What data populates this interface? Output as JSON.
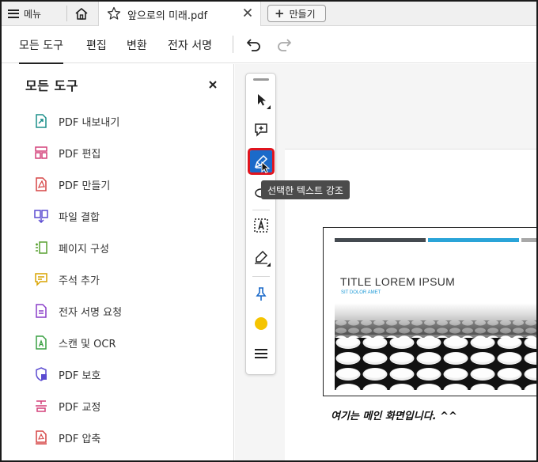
{
  "tabbar": {
    "menu_label": "메뉴",
    "doc_tab_title": "앞으로의 미래.pdf",
    "new_button_label": "만들기"
  },
  "toolbar": {
    "tabs": [
      {
        "label": "모든 도구"
      },
      {
        "label": "편집"
      },
      {
        "label": "변환"
      },
      {
        "label": "전자 서명"
      }
    ],
    "active_tab": "모든 도구"
  },
  "panel": {
    "title": "모든 도구",
    "items": [
      {
        "label": "PDF 내보내기",
        "icon": "pdf-export-icon"
      },
      {
        "label": "PDF 편집",
        "icon": "pdf-edit-icon"
      },
      {
        "label": "PDF 만들기",
        "icon": "pdf-create-icon"
      },
      {
        "label": "파일 결합",
        "icon": "combine-files-icon"
      },
      {
        "label": "페이지 구성",
        "icon": "organize-pages-icon"
      },
      {
        "label": "주석 추가",
        "icon": "add-comment-icon"
      },
      {
        "label": "전자 서명 요청",
        "icon": "request-signature-icon"
      },
      {
        "label": "스캔 및 OCR",
        "icon": "scan-ocr-icon"
      },
      {
        "label": "PDF 보호",
        "icon": "protect-pdf-icon"
      },
      {
        "label": "PDF 교정",
        "icon": "redact-pdf-icon"
      },
      {
        "label": "PDF 압축",
        "icon": "compress-pdf-icon"
      }
    ]
  },
  "quick_tools": {
    "tooltip": "선택한 텍스트 강조",
    "highlight_color": "#f5c400"
  },
  "document": {
    "slide_title": "TITLE LOREM IPSUM",
    "slide_subtitle": "SIT DOLOR AMET",
    "caption": "여기는 메인 화면입니다. ^^"
  },
  "colors": {
    "accent_blue": "#1b6ac9",
    "selection_outline": "#e0141e",
    "slide_bar_dark": "#444a50",
    "slide_bar_blue": "#2aa4d8",
    "slide_bar_gray": "#a8a8a8"
  }
}
